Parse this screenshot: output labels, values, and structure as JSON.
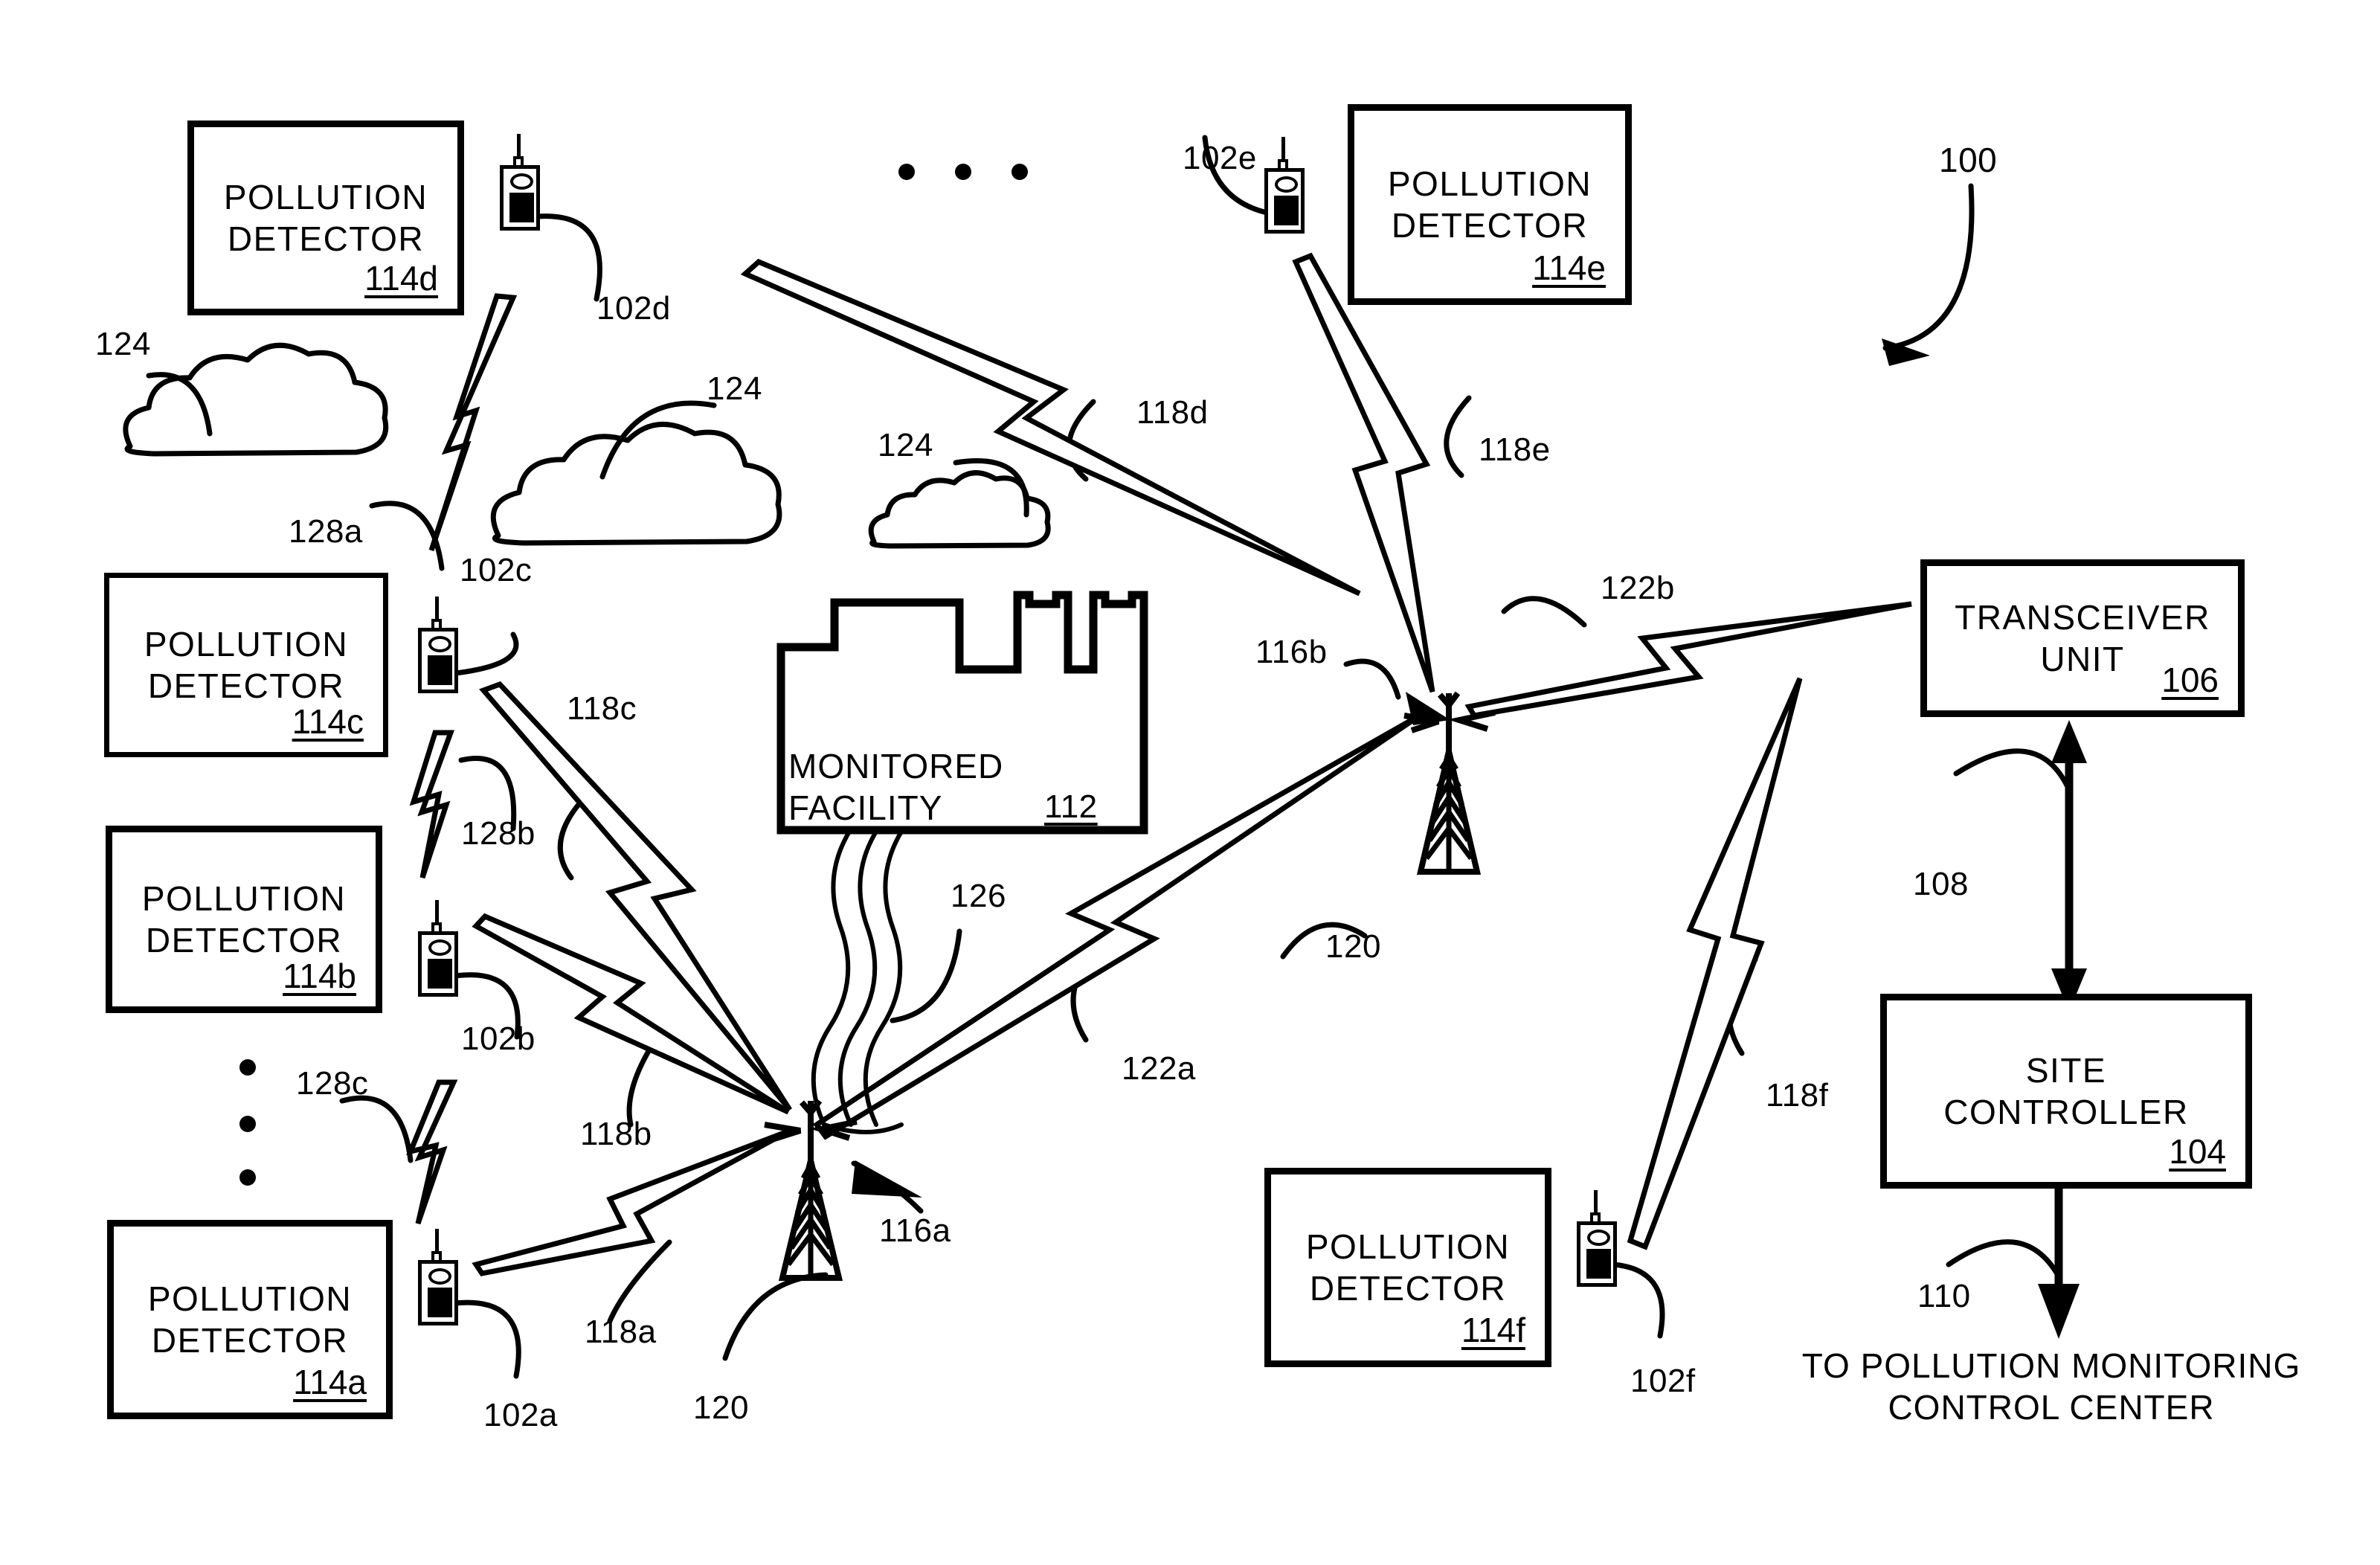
{
  "figure": {
    "ref": "100",
    "type": "patent-diagram",
    "title": "Pollution monitoring system"
  },
  "detectors": [
    {
      "id": "114d",
      "label": "POLLUTION\nDETECTOR",
      "ref": "114d",
      "transmitter_ref": "102d"
    },
    {
      "id": "114e",
      "label": "POLLUTION\nDETECTOR",
      "ref": "114e",
      "transmitter_ref": "102e"
    },
    {
      "id": "114c",
      "label": "POLLUTION\nDETECTOR",
      "ref": "114c",
      "transmitter_ref": "102c"
    },
    {
      "id": "114b",
      "label": "POLLUTION\nDETECTOR",
      "ref": "114b",
      "transmitter_ref": "102b"
    },
    {
      "id": "114a",
      "label": "POLLUTION\nDETECTOR",
      "ref": "114a",
      "transmitter_ref": "102a"
    },
    {
      "id": "114f",
      "label": "POLLUTION\nDETECTOR",
      "ref": "114f",
      "transmitter_ref": "102f"
    }
  ],
  "facility": {
    "label": "MONITORED\nFACILITY",
    "ref": "112",
    "plume_ref": "126"
  },
  "transceiver": {
    "label": "TRANSCEIVER\nUNIT",
    "ref": "106"
  },
  "site_controller": {
    "label": "SITE\nCONTROLLER",
    "ref": "104"
  },
  "output": {
    "caption": "TO POLLUTION MONITORING\nCONTROL CENTER",
    "link_ref": "110"
  },
  "links": {
    "controller_transceiver_ref": "108",
    "detector_links": [
      "118a",
      "118b",
      "118c",
      "118d",
      "118e",
      "118f"
    ],
    "tower_links": [
      "122a",
      "122b"
    ],
    "cloud_links": [
      "128a",
      "128b",
      "128c"
    ]
  },
  "towers": [
    {
      "antenna_ref": "116a",
      "tower_ref": "120"
    },
    {
      "antenna_ref": "116b",
      "tower_ref": "120"
    }
  ],
  "clouds": [
    {
      "ref": "124"
    },
    {
      "ref": "124"
    },
    {
      "ref": "124"
    }
  ],
  "transmitter_refs": [
    "102a",
    "102b",
    "102c",
    "102d",
    "102e",
    "102f"
  ],
  "colors": {
    "ink": "#000000",
    "paper": "#ffffff"
  }
}
